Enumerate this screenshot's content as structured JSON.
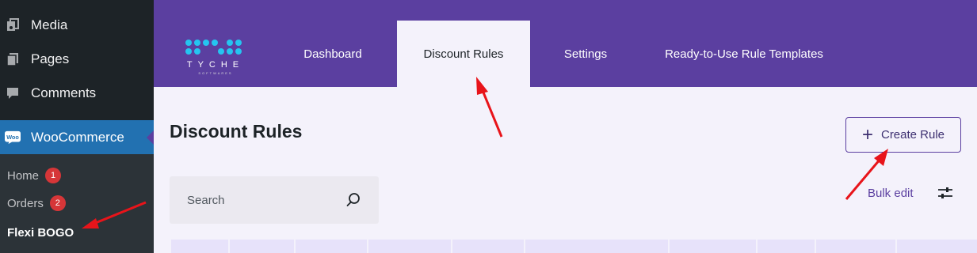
{
  "sidebar": {
    "items": [
      {
        "label": "Media",
        "icon": "media-icon"
      },
      {
        "label": "Pages",
        "icon": "pages-icon"
      },
      {
        "label": "Comments",
        "icon": "comments-icon"
      },
      {
        "label": "WooCommerce",
        "icon": "woo-icon"
      }
    ],
    "woo_icon_text": "Woo",
    "sub": [
      {
        "label": "Home",
        "badge": "1"
      },
      {
        "label": "Orders",
        "badge": "2"
      },
      {
        "label": "Flexi BOGO",
        "badge": null
      }
    ]
  },
  "header": {
    "logo_text": "TYCHE",
    "logo_subtext": "SOFTWARES",
    "tabs": [
      {
        "label": "Dashboard",
        "active": false
      },
      {
        "label": "Discount Rules",
        "active": true
      },
      {
        "label": "Settings",
        "active": false
      },
      {
        "label": "Ready-to-Use Rule Templates",
        "active": false
      }
    ]
  },
  "main": {
    "title": "Discount Rules",
    "create_button": "Create Rule",
    "search_placeholder": "Search",
    "bulk_edit": "Bulk edit"
  },
  "colors": {
    "header_purple": "#5b3fa0",
    "wp_sidebar": "#1d2327",
    "wp_active": "#2271b1",
    "annotation_arrow": "#e8141a"
  }
}
